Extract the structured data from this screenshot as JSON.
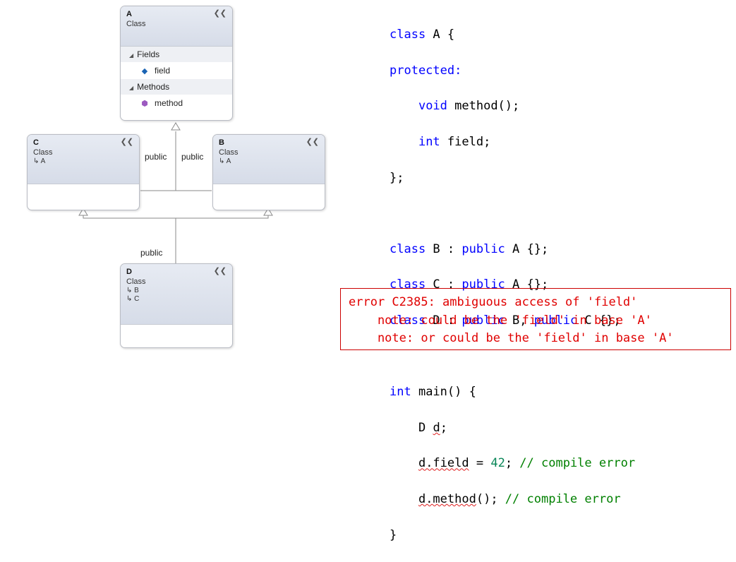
{
  "classes": {
    "a": {
      "name": "A",
      "kind": "Class",
      "collapse_icon": "chevron-double-up-icon",
      "sections": {
        "fields_label": "Fields",
        "field": "field",
        "methods_label": "Methods",
        "method": "method"
      }
    },
    "c": {
      "name": "C",
      "kind": "Class",
      "base": "A",
      "collapse_icon": "chevron-double-up-icon"
    },
    "b": {
      "name": "B",
      "kind": "Class",
      "base": "A",
      "collapse_icon": "chevron-double-up-icon"
    },
    "d": {
      "name": "D",
      "kind": "Class",
      "bases": [
        "B",
        "C"
      ],
      "collapse_icon": "chevron-double-up-icon"
    }
  },
  "edge_labels": {
    "c_to_a": "public",
    "b_to_a": "public",
    "d_to_bc": "public"
  },
  "inherit_prefix": "↳",
  "code": {
    "l1": [
      "class",
      " A {"
    ],
    "l2": "protected:",
    "l3": [
      "    ",
      "void",
      " method();"
    ],
    "l4": [
      "    ",
      "int",
      " field;"
    ],
    "l5": "};",
    "l6": [
      "class",
      " B : ",
      "public",
      " A {};"
    ],
    "l7": [
      "class",
      " C : ",
      "public",
      " A {};"
    ],
    "l8": [
      "class",
      " D : ",
      "public",
      " B, ",
      "public",
      " C {};"
    ],
    "l9": [
      "int",
      " main() {"
    ],
    "l10": [
      "    ",
      "D ",
      "d",
      ";"
    ],
    "l11": [
      "    ",
      "d.field",
      " = ",
      "42",
      "; ",
      "// compile error"
    ],
    "l12": [
      "    ",
      "d.method",
      "(); ",
      "// compile error"
    ],
    "l13": "}"
  },
  "error": {
    "line1": "error C2385: ambiguous access of 'field'",
    "line2": "    note: could be the 'field' in base 'A'",
    "line3": "    note: or could be the 'field' in base 'A'"
  },
  "colors": {
    "keyword": "#0000ff",
    "number": "#098658",
    "comment": "#008000",
    "error": "#e00000"
  }
}
